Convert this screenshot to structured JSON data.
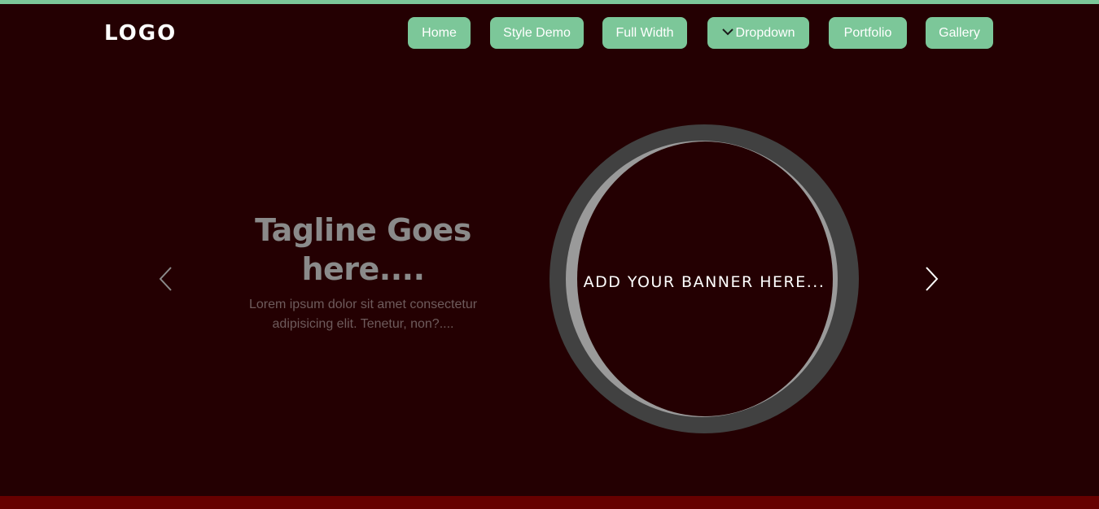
{
  "header": {
    "logo": "LOGO",
    "nav": {
      "home": "Home",
      "style_demo": "Style Demo",
      "full_width": "Full Width",
      "dropdown": "Dropdown",
      "portfolio": "Portfolio",
      "gallery": "Gallery"
    }
  },
  "slider": {
    "tagline": "Tagline Goes here....",
    "subtext": "Lorem ipsum dolor sit amet consectetur adipisicing elit. Tenetur, non?....",
    "banner_text": "ADD YOUR BANNER HERE..."
  },
  "icons": {
    "dropdown": "chevron-down-icon",
    "prev": "chevron-left-icon",
    "next": "chevron-right-icon"
  },
  "colors": {
    "background": "#240002",
    "accent": "#7cc799",
    "footer_strip": "#660000"
  }
}
